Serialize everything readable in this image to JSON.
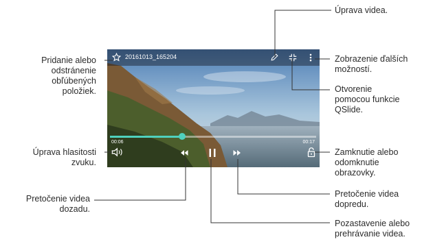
{
  "player": {
    "file_name": "20161013_165204",
    "time_elapsed": "00:06",
    "time_total": "00:17",
    "progress_fraction": 0.35,
    "accent_color": "#4fd1bd"
  },
  "icons": {
    "favorite": "star-outline-icon",
    "edit": "pencil-icon",
    "qslide": "qslide-icon",
    "more": "more-vertical-icon",
    "volume": "volume-icon",
    "rewind": "rewind-icon",
    "pause": "pause-icon",
    "forward": "fast-forward-icon",
    "lock": "lock-icon"
  },
  "labels": {
    "edit": "Úprava videa.",
    "favorite": [
      "Pridanie alebo",
      "odstránenie",
      "obľúbených",
      "položiek."
    ],
    "more": [
      "Zobrazenie ďalších",
      "možností."
    ],
    "qslide": [
      "Otvorenie",
      "pomocou funkcie",
      "QSlide."
    ],
    "volume": [
      "Úprava hlasitosti",
      "zvuku."
    ],
    "lock": [
      "Zamknutie alebo",
      "odomknutie",
      "obrazovky."
    ],
    "rewind": [
      "Pretočenie videa",
      "dozadu."
    ],
    "forward": [
      "Pretočenie videa",
      "dopredu."
    ],
    "pause": [
      "Pozastavenie alebo",
      "prehrávanie videa."
    ]
  }
}
